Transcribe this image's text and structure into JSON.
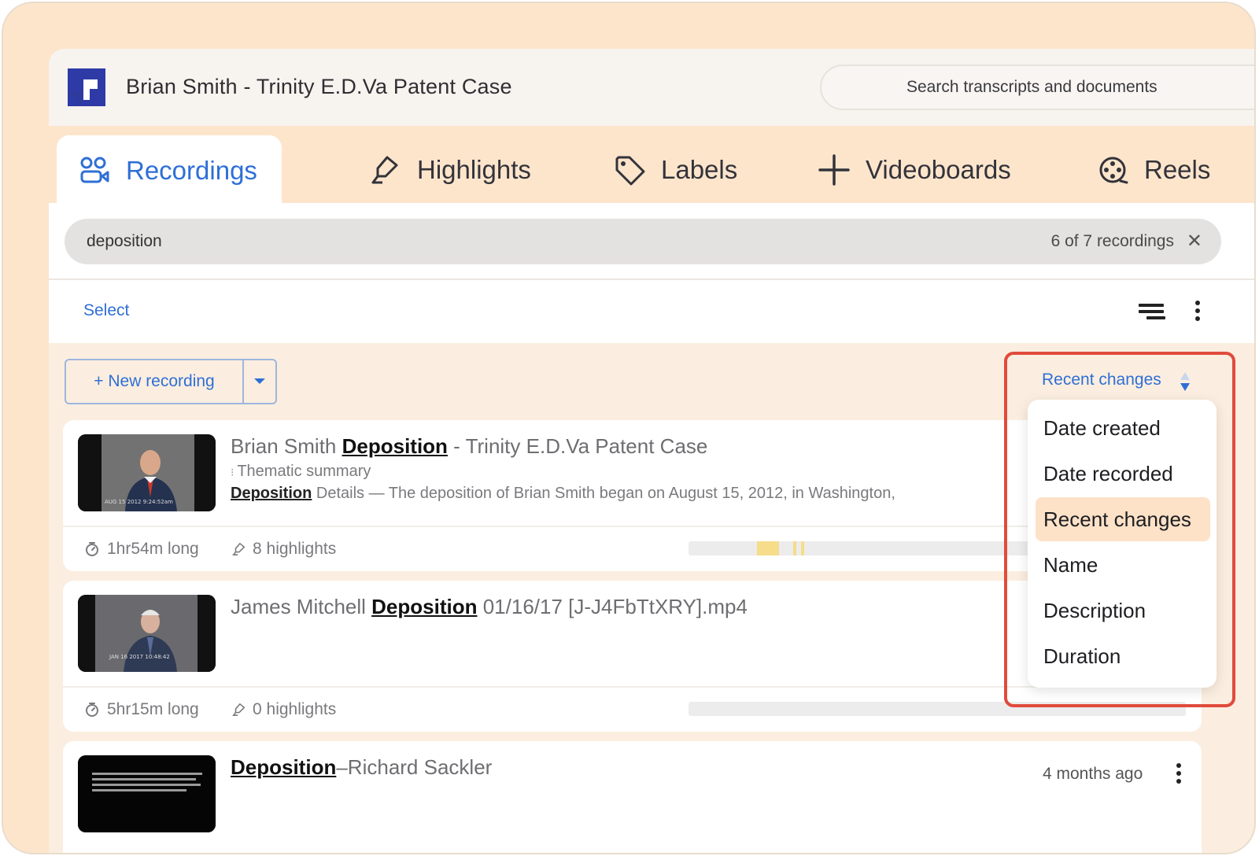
{
  "header": {
    "case_title": "Brian Smith - Trinity E.D.Va Patent Case",
    "search_placeholder": "Search transcripts and documents"
  },
  "tabs": [
    {
      "label": "Recordings",
      "icon": "recordings-icon",
      "active": true
    },
    {
      "label": "Highlights",
      "icon": "highlighter-icon",
      "active": false
    },
    {
      "label": "Labels",
      "icon": "tag-icon",
      "active": false
    },
    {
      "label": "Videoboards",
      "icon": "plus-icon",
      "active": false
    },
    {
      "label": "Reels",
      "icon": "reel-icon",
      "active": false
    }
  ],
  "filter": {
    "query": "deposition",
    "count_text": "6 of 7 recordings",
    "clear": "✕"
  },
  "toolbar": {
    "select_label": "Select",
    "new_recording_label": "+ New recording",
    "sort_label": "Recent changes"
  },
  "sort_menu": {
    "options": [
      "Date created",
      "Date recorded",
      "Recent changes",
      "Name",
      "Description",
      "Duration"
    ],
    "selected": "Recent changes"
  },
  "recordings": [
    {
      "title_before": "Brian Smith ",
      "title_match": "Deposition",
      "title_after": " - Trinity E.D.Va Patent Case",
      "subtitle": "Thematic summary",
      "desc_match": "Deposition",
      "desc_rest": " Details — The deposition of Brian Smith began on August 15, 2012, in Washington,",
      "duration": "1hr54m long",
      "highlights": "8 highlights",
      "thumb_stamp": "AUG 15 2012   9:24:52am",
      "timeline_marks": [
        {
          "start": 0.137,
          "end": 0.181,
          "color": "#f5dd8a"
        },
        {
          "start": 0.21,
          "end": 0.217,
          "color": "#f5dd8a"
        },
        {
          "start": 0.227,
          "end": 0.234,
          "color": "#f5dd8a"
        }
      ]
    },
    {
      "title_before": "James Mitchell ",
      "title_match": "Deposition",
      "title_after": " 01/16/17 [J-J4FbTtXRY].mp4",
      "duration": "5hr15m long",
      "highlights": "0 highlights",
      "thumb_stamp": "JAN 16 2017   10:48:42"
    },
    {
      "title_before": "",
      "title_match": "Deposition",
      "title_after": "–Richard Sackler",
      "modified": "4 months ago"
    }
  ],
  "colors": {
    "accent": "#2f6fd6",
    "frame": "#fde5cc",
    "callout": "#e04b3c",
    "selected_option": "#fde2c8"
  }
}
